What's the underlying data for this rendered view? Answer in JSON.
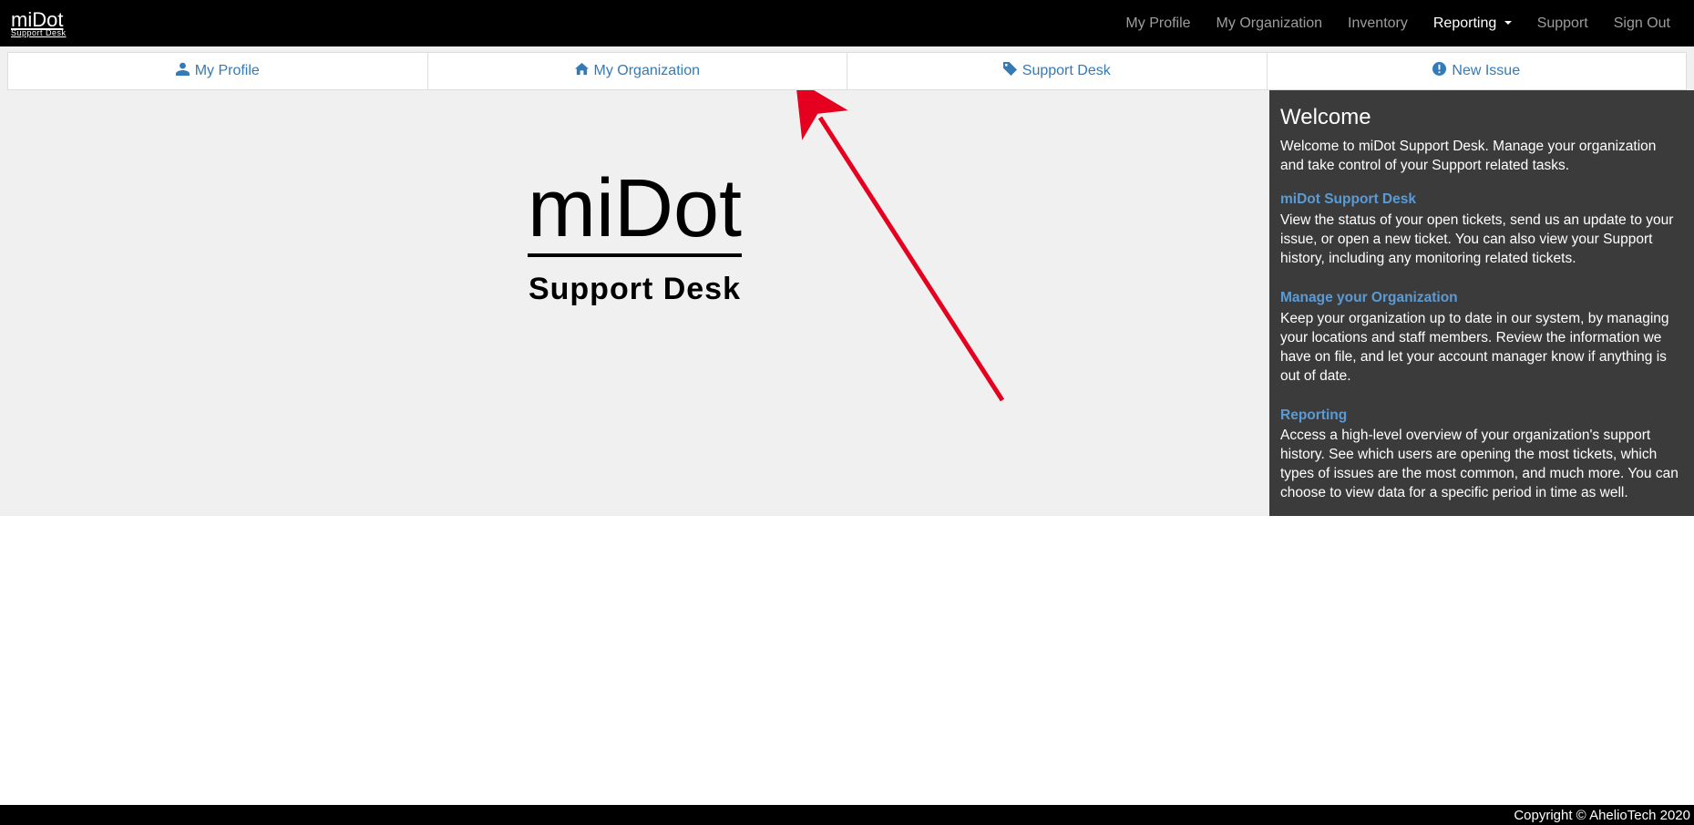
{
  "brand": {
    "top": "miDot",
    "bottom": "Support Desk"
  },
  "nav": {
    "profile": "My Profile",
    "organization": "My Organization",
    "inventory": "Inventory",
    "reporting": "Reporting",
    "support": "Support",
    "signout": "Sign Out"
  },
  "tabs": {
    "profile": "My Profile",
    "organization": "My Organization",
    "support_desk": "Support Desk",
    "new_issue": "New Issue"
  },
  "logo": {
    "title": "miDot",
    "subtitle": "Support Desk"
  },
  "sidebar": {
    "welcome_title": "Welcome",
    "welcome_text": "Welcome to miDot Support Desk. Manage your organization and take control of your Support related tasks.",
    "sec1_title": "miDot Support Desk",
    "sec1_text": "View the status of your open tickets, send us an update to your issue, or open a new ticket. You can also view your Support history, including any monitoring related tickets.",
    "sec2_title": "Manage your Organization",
    "sec2_text": "Keep your organization up to date in our system, by managing your locations and staff members. Review the information we have on file, and let your account manager know if anything is out of date.",
    "sec3_title": "Reporting",
    "sec3_text": "Access a high-level overview of your organization's support history. See which users are opening the most tickets, which types of issues are the most common, and much more. You can choose to view data for a specific period in time as well."
  },
  "footer": "Copyright © AhelioTech 2020"
}
